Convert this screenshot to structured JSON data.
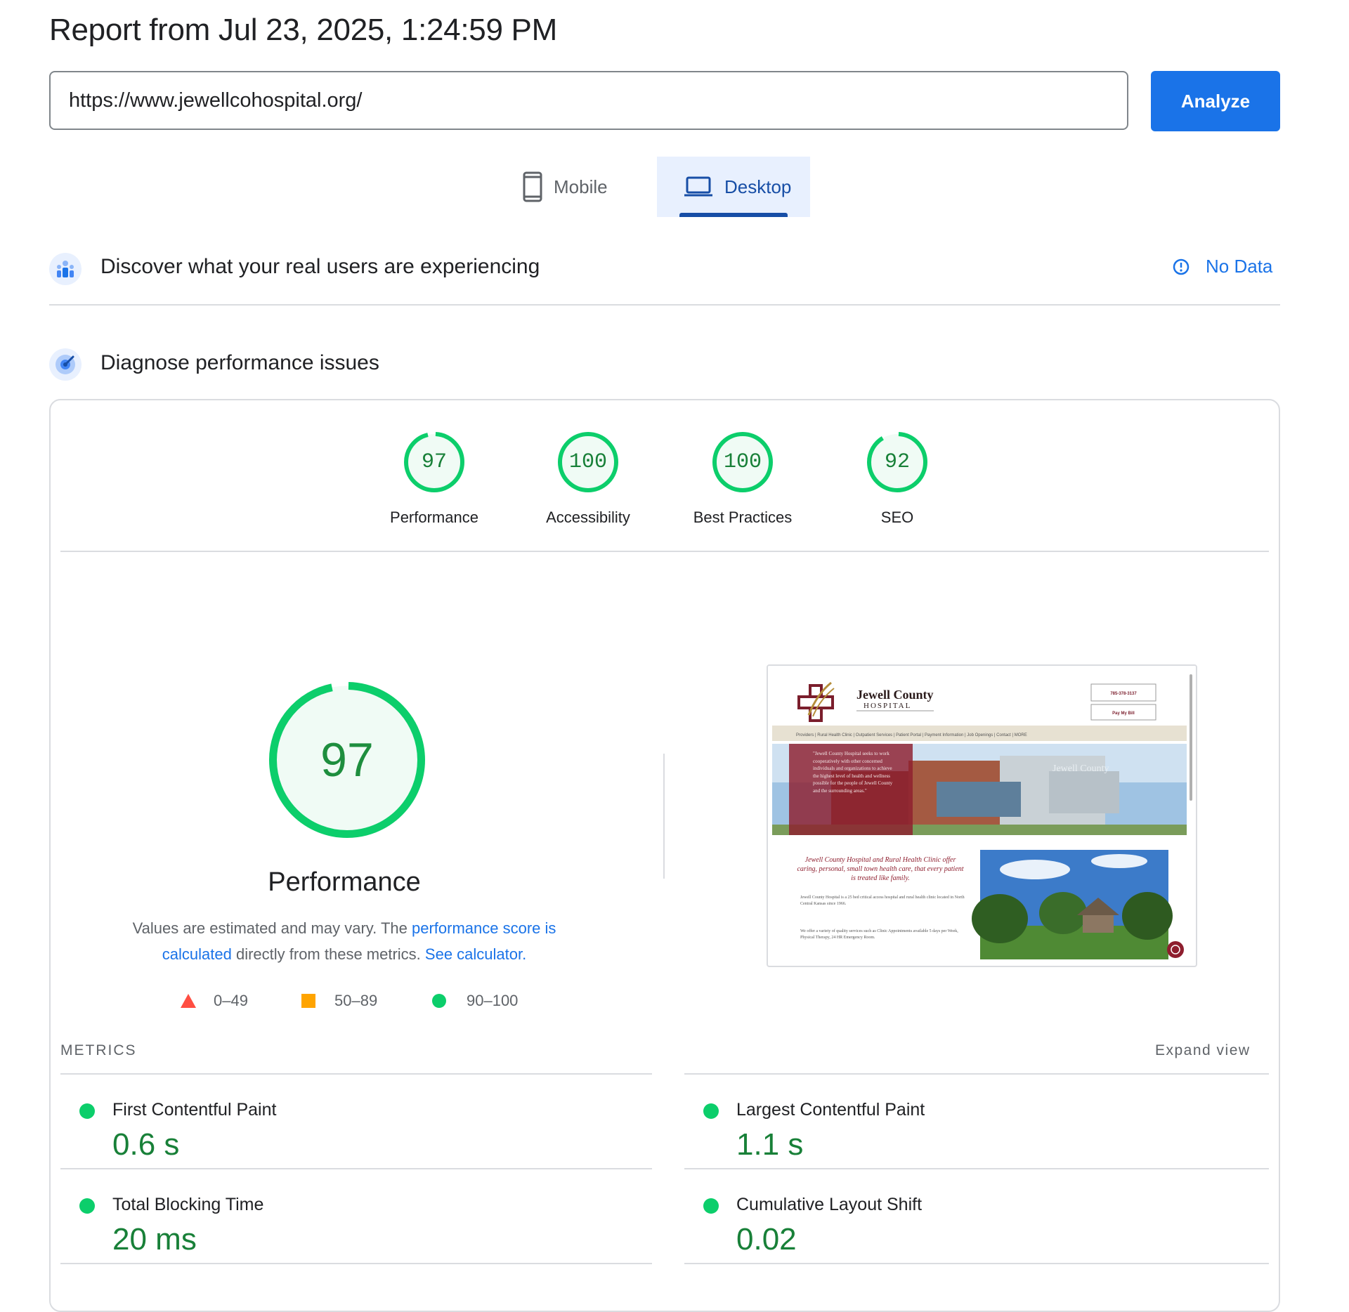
{
  "header": {
    "report_title": "Report from Jul 23, 2025, 1:24:59 PM",
    "url_value": "https://www.jewellcohospital.org/",
    "analyze_label": "Analyze"
  },
  "tabs": {
    "mobile_label": "Mobile",
    "desktop_label": "Desktop",
    "selected": "Desktop"
  },
  "field_data": {
    "title": "Discover what your real users are experiencing",
    "status": "No Data"
  },
  "lab_data": {
    "title": "Diagnose performance issues"
  },
  "scores": [
    {
      "label": "Performance",
      "value": 97
    },
    {
      "label": "Accessibility",
      "value": 100
    },
    {
      "label": "Best Practices",
      "value": 100
    },
    {
      "label": "SEO",
      "value": 92
    }
  ],
  "main_gauge": {
    "value": 97,
    "label": "Performance",
    "desc_prefix": "Values are estimated and may vary. The ",
    "desc_link1": "performance score is calculated",
    "desc_middle": " directly from these metrics. ",
    "desc_link2": "See calculator."
  },
  "legend": {
    "fail": "0–49",
    "average": "50–89",
    "pass": "90–100"
  },
  "metrics": {
    "heading": "METRICS",
    "expand_label": "Expand view",
    "items": [
      {
        "name": "First Contentful Paint",
        "value": "0.6 s"
      },
      {
        "name": "Largest Contentful Paint",
        "value": "1.1 s"
      },
      {
        "name": "Total Blocking Time",
        "value": "20 ms"
      },
      {
        "name": "Cumulative Layout Shift",
        "value": "0.02"
      }
    ]
  },
  "colors": {
    "accent": "#1a73e8",
    "pass": "#0cce6b",
    "pass_text": "#188038",
    "average": "#ffa400",
    "fail": "#ff4e42"
  },
  "thumbnail": {
    "site_name": "Jewell County",
    "site_sub": "HOSPITAL",
    "btn1": "785-378-3137",
    "btn2": "Pay My Bill",
    "nav": "Providers | Rural Health Clinic | Outpatient Services | Patient Portal | Payment Information | Job Openings | Contact | MORE",
    "quote": "\"Jewell County Hospital seeks to work cooperatively with other concerned individuals and organizations to achieve the highest level of health and wellness possible for the people of Jewell County and the surrounding areas.\"",
    "tagline": "Jewell County Hospital and Rural Health Clinic offer caring, personal, small town health care, that every patient is treated like family.",
    "body1": "Jewell County Hospital is a 25 bed critical access hospital and rural health clinic located in North Central Kansas since 1966.",
    "body2": "We offer a variety of quality services such as Clinic Appointments available 5 days per Week, Physical Therapy, 24 HR Emergency Room."
  }
}
